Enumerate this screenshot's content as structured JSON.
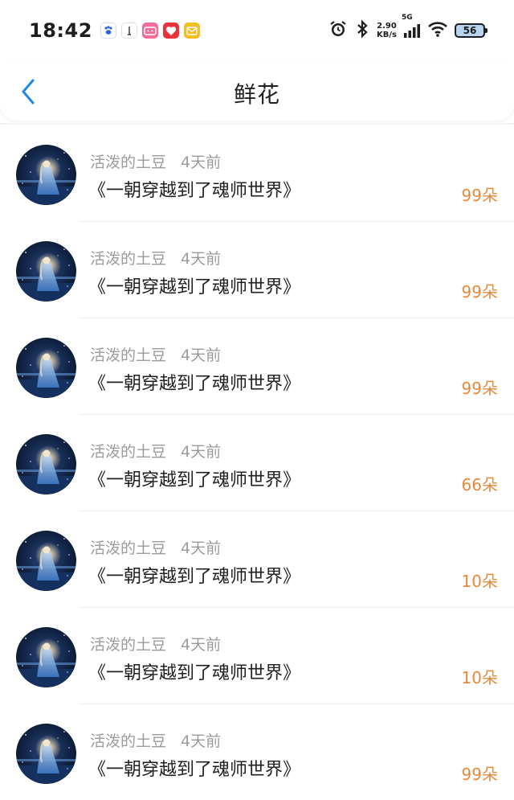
{
  "status": {
    "time": "18:42",
    "speed_value": "2.90",
    "speed_unit": "KB/s",
    "network": "5G",
    "battery": "56"
  },
  "header": {
    "title": "鲜花"
  },
  "colors": {
    "accent": "#1e88e5",
    "count": "#e58a3a"
  },
  "items": [
    {
      "user": "活泼的土豆",
      "time": "4天前",
      "book": "《一朝穿越到了魂师世界》",
      "count": "99朵"
    },
    {
      "user": "活泼的土豆",
      "time": "4天前",
      "book": "《一朝穿越到了魂师世界》",
      "count": "99朵"
    },
    {
      "user": "活泼的土豆",
      "time": "4天前",
      "book": "《一朝穿越到了魂师世界》",
      "count": "99朵"
    },
    {
      "user": "活泼的土豆",
      "time": "4天前",
      "book": "《一朝穿越到了魂师世界》",
      "count": "66朵"
    },
    {
      "user": "活泼的土豆",
      "time": "4天前",
      "book": "《一朝穿越到了魂师世界》",
      "count": "10朵"
    },
    {
      "user": "活泼的土豆",
      "time": "4天前",
      "book": "《一朝穿越到了魂师世界》",
      "count": "10朵"
    },
    {
      "user": "活泼的土豆",
      "time": "4天前",
      "book": "《一朝穿越到了魂师世界》",
      "count": "99朵"
    }
  ]
}
